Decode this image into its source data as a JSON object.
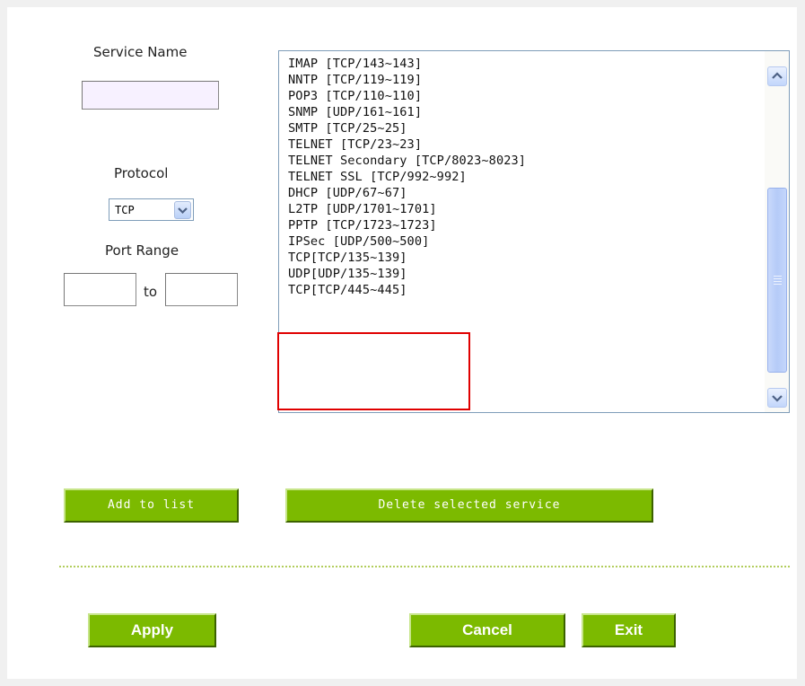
{
  "form": {
    "service_name_label": "Service Name",
    "service_name_value": "",
    "protocol_label": "Protocol",
    "protocol_selected": "TCP",
    "port_range_label": "Port Range",
    "port_from": "",
    "port_to": "",
    "to_label": "to"
  },
  "service_list": {
    "items": [
      "IMAP [TCP/143~143]",
      "NNTP [TCP/119~119]",
      "POP3 [TCP/110~110]",
      "SNMP [UDP/161~161]",
      "SMTP [TCP/25~25]",
      "TELNET [TCP/23~23]",
      "TELNET Secondary [TCP/8023~8023]",
      "TELNET SSL [TCP/992~992]",
      "DHCP [UDP/67~67]",
      "L2TP [UDP/1701~1701]",
      "PPTP [TCP/1723~1723]",
      "IPSec [UDP/500~500]",
      "TCP[TCP/135~139]",
      "UDP[UDP/135~139]",
      "TCP[TCP/445~445]"
    ],
    "highlighted_items": [
      "TCP[TCP/135~139]",
      "UDP[UDP/135~139]",
      "TCP[TCP/445~445]"
    ],
    "highlight_color": "#e00000"
  },
  "buttons": {
    "add_to_list": "Add to list",
    "delete_selected": "Delete selected service",
    "apply": "Apply",
    "cancel": "Cancel",
    "exit": "Exit"
  },
  "colors": {
    "button_green": "#7cba00",
    "divider": "#b2cd5c"
  }
}
